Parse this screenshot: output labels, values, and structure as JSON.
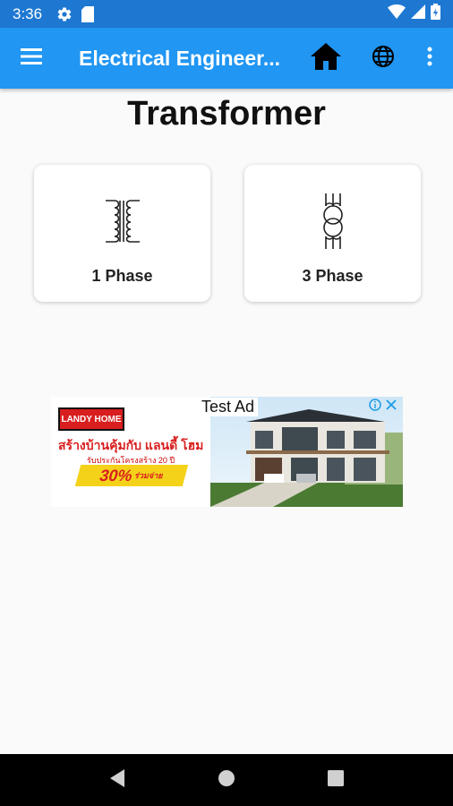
{
  "status_bar": {
    "time": "3:36",
    "icons": [
      "settings-icon",
      "sd-card-icon",
      "wifi-icon",
      "signal-icon",
      "battery-icon"
    ]
  },
  "app_bar": {
    "title": "Electrical Engineer...",
    "icons": [
      "menu-icon",
      "home-icon",
      "globe-icon",
      "more-vert-icon"
    ],
    "color": "#2196f3"
  },
  "page": {
    "title": "Transformer"
  },
  "cards": [
    {
      "label": "1 Phase",
      "icon": "single-phase-transformer-icon"
    },
    {
      "label": "3 Phase",
      "icon": "three-phase-transformer-icon"
    }
  ],
  "ad": {
    "label": "Test Ad",
    "logo_text": "LANDY HOME",
    "headline": "สร้างบ้านคุ้มกับ แลนดี้ โฮม",
    "subline": "รับประกันโครงสร้าง 20 ปี",
    "promo": "30%",
    "promo_suffix": "ร่วมจ่าย"
  },
  "nav_bar": {
    "icons": [
      "back-icon",
      "home-circle-icon",
      "recents-icon"
    ]
  }
}
